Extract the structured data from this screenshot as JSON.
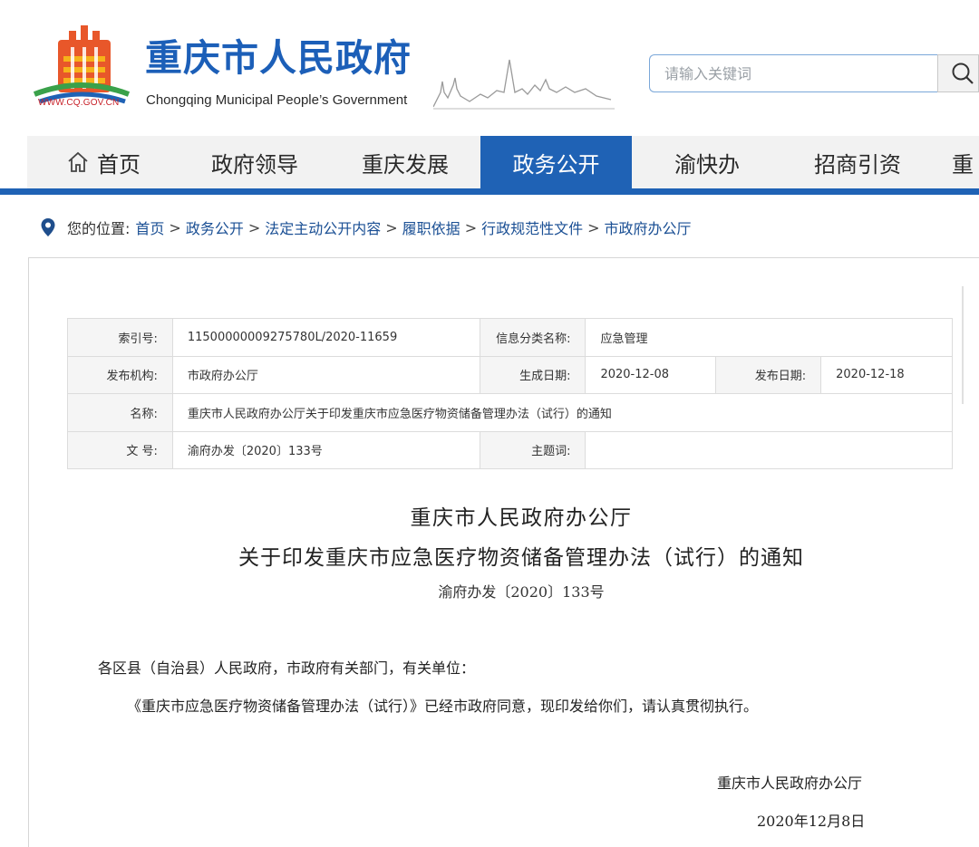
{
  "header": {
    "logo_url": "WWW.CQ.GOV.CN",
    "title_cn": "重庆市人民政府",
    "title_en": "Chongqing Municipal People’s Government",
    "search_placeholder": "请输入关键词",
    "accent_color": "#1f62b5",
    "logo_colors": [
      "#e8572a",
      "#f6b21a",
      "#c8222a",
      "#3aa14a",
      "#1f62b5"
    ]
  },
  "nav": {
    "items": [
      {
        "label": "首页",
        "icon": "home-icon",
        "active": false
      },
      {
        "label": "政府领导",
        "active": false
      },
      {
        "label": "重庆发展",
        "active": false
      },
      {
        "label": "政务公开",
        "active": true
      },
      {
        "label": "渝快办",
        "active": false
      },
      {
        "label": "招商引资",
        "active": false
      },
      {
        "label": "重",
        "active": false
      }
    ]
  },
  "breadcrumb": {
    "label": "您的位置:",
    "items": [
      "首页",
      "政务公开",
      "法定主动公开内容",
      "履职依据",
      "行政规范性文件",
      "市政府办公厅"
    ],
    "separator": ">"
  },
  "meta": {
    "index_label": "索引号:",
    "index_value": "11500000009275780L/2020-11659",
    "category_label": "信息分类名称:",
    "category_value": "应急管理",
    "org_label": "发布机构:",
    "org_value": "市政府办公厅",
    "created_label": "生成日期:",
    "created_value": "2020-12-08",
    "published_label": "发布日期:",
    "published_value": "2020-12-18",
    "name_label": "名称:",
    "name_value": "重庆市人民政府办公厅关于印发重庆市应急医疗物资储备管理办法（试行）的通知",
    "docno_label": "文 号:",
    "docno_value": "渝府办发〔2020〕133号",
    "subject_label": "主题词:",
    "subject_value": ""
  },
  "document": {
    "title_line1": "重庆市人民政府办公厅",
    "title_line2": "关于印发重庆市应急医疗物资储备管理办法（试行）的通知",
    "doc_number": "渝府办发〔2020〕133号",
    "salutation": "各区县（自治县）人民政府，市政府有关部门，有关单位：",
    "body": "《重庆市应急医疗物资储备管理办法（试行）》已经市政府同意，现印发给你们，请认真贯彻执行。",
    "signature": "重庆市人民政府办公厅",
    "date": "2020年12月8日"
  }
}
